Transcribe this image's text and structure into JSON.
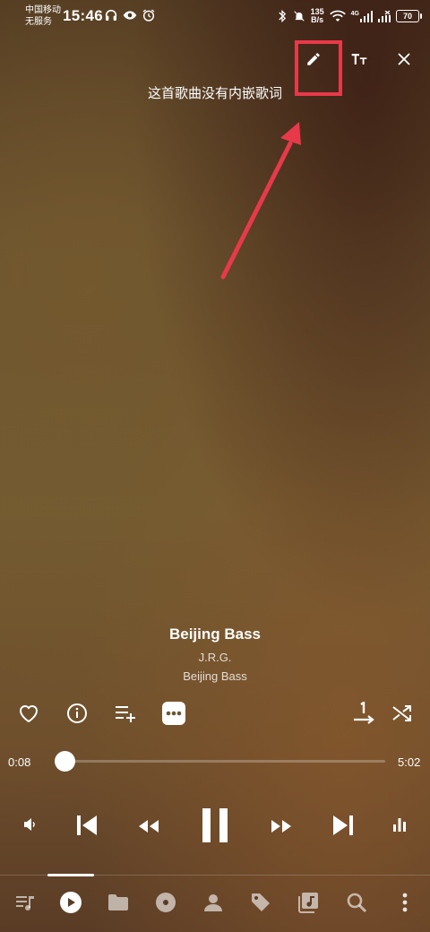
{
  "status_bar": {
    "carrier_line1": "中国移动",
    "carrier_line2": "无服务",
    "time": "15:46",
    "speed_value": "135",
    "speed_unit": "B/s",
    "network": "4G",
    "battery": "70"
  },
  "lyrics": {
    "message": "这首歌曲没有内嵌歌词"
  },
  "track": {
    "title": "Beijing Bass",
    "artist": "J.R.G.",
    "album": "Beijing Bass"
  },
  "progress": {
    "current": "0:08",
    "total": "5:02",
    "fraction": 0.026
  },
  "colors": {
    "highlight": "#e8394a"
  },
  "icons": {
    "edit": "pencil-icon",
    "text_size": "text-size-icon",
    "close": "close-icon",
    "favorite": "heart-icon",
    "info": "info-icon",
    "add_to_queue": "playlist-add-icon",
    "more": "more-icon",
    "repeat": "repeat-one-icon",
    "shuffle": "shuffle-icon"
  }
}
